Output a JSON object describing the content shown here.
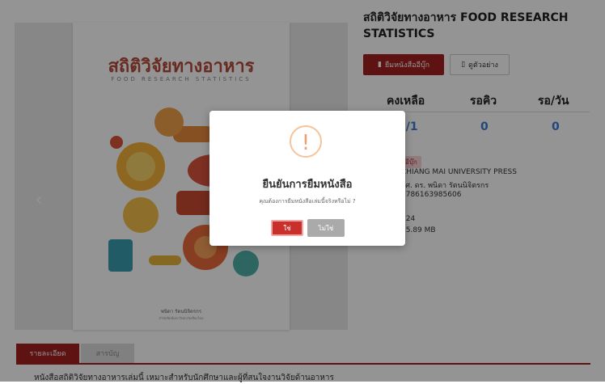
{
  "book": {
    "title": "สถิติวิจัยทางอาหาร FOOD RESEARCH STATISTICS",
    "cover_title": "สถิติวิจัยทางอาหาร",
    "cover_subtitle": "FOOD RESEARCH STATISTICS",
    "cover_author": "พนิดา รัตนนิจิตรกร",
    "cover_publisher": "สำนักพิมพ์มหาวิทยาลัยเชียงใหม่"
  },
  "actions": {
    "borrow_label": "ยืมหนังสืออีบุ๊ก",
    "sample_label": "ดูตัวอย่าง"
  },
  "stats": {
    "headers": [
      "คงเหลือ",
      "รอคิว",
      "รอ/วัน"
    ],
    "values": [
      "1/1",
      "0",
      "0"
    ]
  },
  "details": {
    "tag": "อีบุ๊ก",
    "publisher": "CHIANG MAI UNIVERSITY PRESS",
    "author": "ผศ. ดร. พนิดา รัตนนิจิตรกร",
    "isbn": "9786163985606",
    "pages": "324",
    "size": "15.89 MB"
  },
  "tabs": {
    "detail_label": "รายละเอียด",
    "second_label": "สารบัญ"
  },
  "description": "หนังสือสถิติวิจัยทางอาหารเล่มนี้ เหมาะสำหรับนักศึกษาและผู้ที่สนใจงานวิจัยด้านอาหาร",
  "modal": {
    "icon_glyph": "!",
    "title": "ยืนยันการยืมหนังสือ",
    "message": "คุณต้องการยืมหนังสือเล่มนี้จริงหรือไม่ ?",
    "confirm_label": "ใช่",
    "cancel_label": "ไม่ใช่"
  },
  "colors": {
    "primary": "#a31f1f",
    "link_blue": "#3a7bd5",
    "warning": "#f0a070"
  }
}
